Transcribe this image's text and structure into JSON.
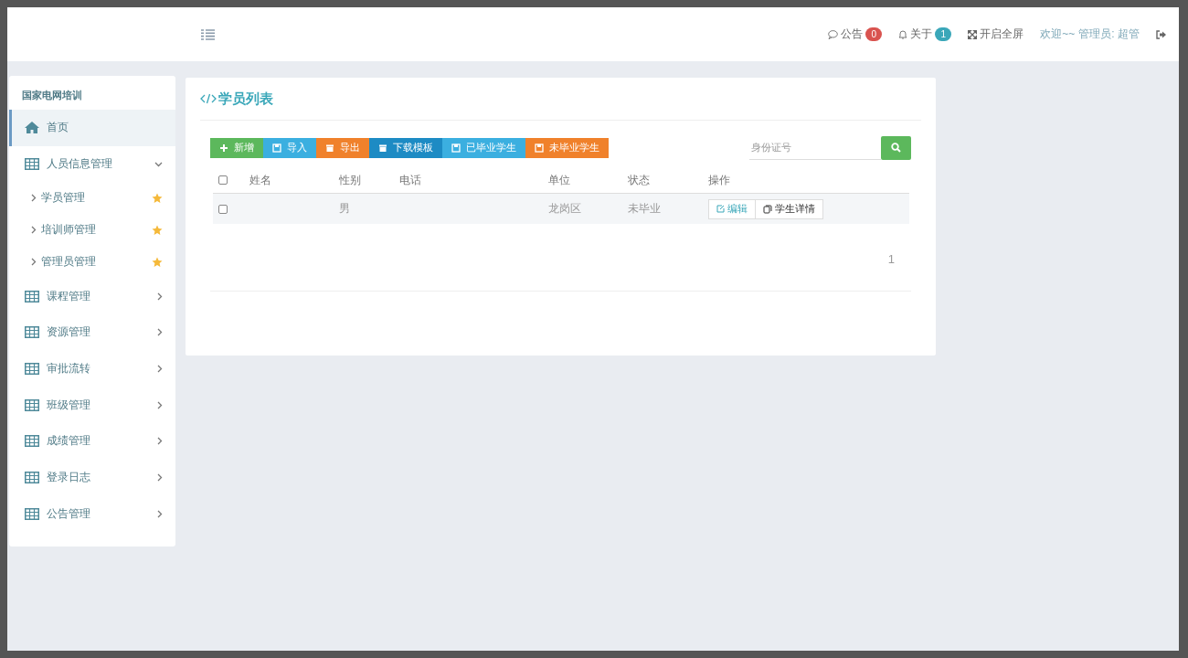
{
  "header": {
    "notice": {
      "label": "公告",
      "count": "0"
    },
    "about": {
      "label": "关于",
      "count": "1"
    },
    "fullscreen": "开启全屏",
    "welcome": "欢迎~~",
    "user": "管理员: 超管"
  },
  "sidebar": {
    "title": "国家电网培训",
    "items": [
      {
        "kind": "home",
        "label": "首页",
        "selected": true
      },
      {
        "kind": "group",
        "label": "人员信息管理",
        "selected": false,
        "expanded": true,
        "children": [
          {
            "label": "学员管理",
            "starred": true
          },
          {
            "label": "培训师管理",
            "starred": true
          },
          {
            "label": "管理员管理",
            "starred": true
          }
        ]
      },
      {
        "kind": "group",
        "label": "课程管理",
        "selected": false,
        "expanded": false
      },
      {
        "kind": "group",
        "label": "资源管理",
        "selected": false,
        "expanded": false
      },
      {
        "kind": "group",
        "label": "审批流转",
        "selected": false,
        "expanded": false
      },
      {
        "kind": "group",
        "label": "班级管理",
        "selected": false,
        "expanded": false
      },
      {
        "kind": "group",
        "label": "成绩管理",
        "selected": false,
        "expanded": false
      },
      {
        "kind": "group",
        "label": "登录日志",
        "selected": false,
        "expanded": false
      },
      {
        "kind": "group",
        "label": "公告管理",
        "selected": false,
        "expanded": false
      }
    ]
  },
  "panel": {
    "title": "学员列表",
    "toolbar": [
      {
        "label": "新增",
        "color": "#5cb85c"
      },
      {
        "label": "导入",
        "color": "#3bafe0"
      },
      {
        "label": "导出",
        "color": "#f0812b"
      },
      {
        "label": "下载模板",
        "color": "#1d8bc4"
      },
      {
        "label": "已毕业学生",
        "color": "#3bafe0"
      },
      {
        "label": "未毕业学生",
        "color": "#f0812b"
      }
    ],
    "search": {
      "placeholder": "身份证号"
    },
    "table": {
      "select_all": {
        "checked": false
      },
      "columns": [
        "姓名",
        "性别",
        "电话",
        "单位",
        "状态",
        "操作"
      ],
      "rows": [
        {
          "checked": false,
          "cells": [
            "",
            "男",
            "",
            "龙岗区",
            "未毕业"
          ],
          "actions": [
            "编辑",
            "学生详情"
          ]
        }
      ]
    },
    "pagination": [
      "1"
    ]
  }
}
